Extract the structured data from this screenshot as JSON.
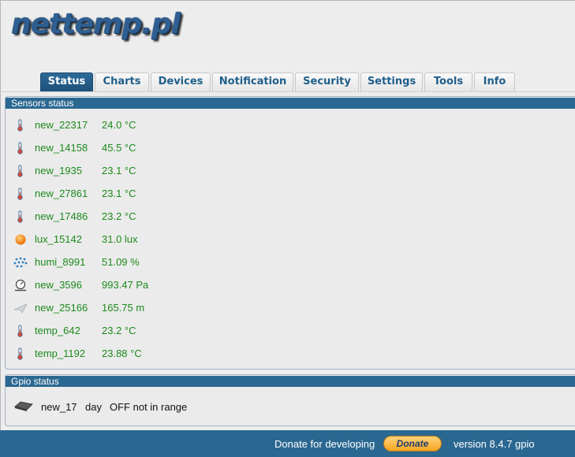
{
  "logo": "nettemp.pl",
  "tabs": [
    "Status",
    "Charts",
    "Devices",
    "Notification",
    "Security",
    "Settings",
    "Tools",
    "Info"
  ],
  "sensors_panel": {
    "title": "Sensors status",
    "rows": [
      {
        "icon": "thermometer-icon",
        "name": "new_22317",
        "value": "24.0 °C"
      },
      {
        "icon": "thermometer-icon",
        "name": "new_14158",
        "value": "45.5 °C"
      },
      {
        "icon": "thermometer-icon",
        "name": "new_1935",
        "value": "23.1 °C"
      },
      {
        "icon": "thermometer-icon",
        "name": "new_27861",
        "value": "23.1 °C"
      },
      {
        "icon": "thermometer-icon",
        "name": "new_17486",
        "value": "23.2 °C"
      },
      {
        "icon": "sun-icon",
        "name": "lux_15142",
        "value": "31.0 lux"
      },
      {
        "icon": "humidity-icon",
        "name": "humi_8991",
        "value": "51.09  %"
      },
      {
        "icon": "pressure-gauge-icon",
        "name": "new_3596",
        "value": "993.47 Pa"
      },
      {
        "icon": "altitude-plane-icon",
        "name": "new_25166",
        "value": "165.75 m"
      },
      {
        "icon": "thermometer-icon",
        "name": "temp_642",
        "value": "23.2 °C"
      },
      {
        "icon": "thermometer-icon",
        "name": "temp_1192",
        "value": "23.88 °C"
      }
    ]
  },
  "gpio_panel": {
    "title": "Gpio status",
    "row": {
      "icon": "gpio-chip-icon",
      "name": "new_17",
      "mode": "day",
      "state": "OFF not in range"
    }
  },
  "footer": {
    "donate_text": "Donate for developing",
    "donate_button": "Donate",
    "version": "version 8.4.7 gpio"
  },
  "colors": {
    "accent": "#2b6891",
    "sensor_text": "#1c8a1c",
    "donate": "#f6a521"
  }
}
